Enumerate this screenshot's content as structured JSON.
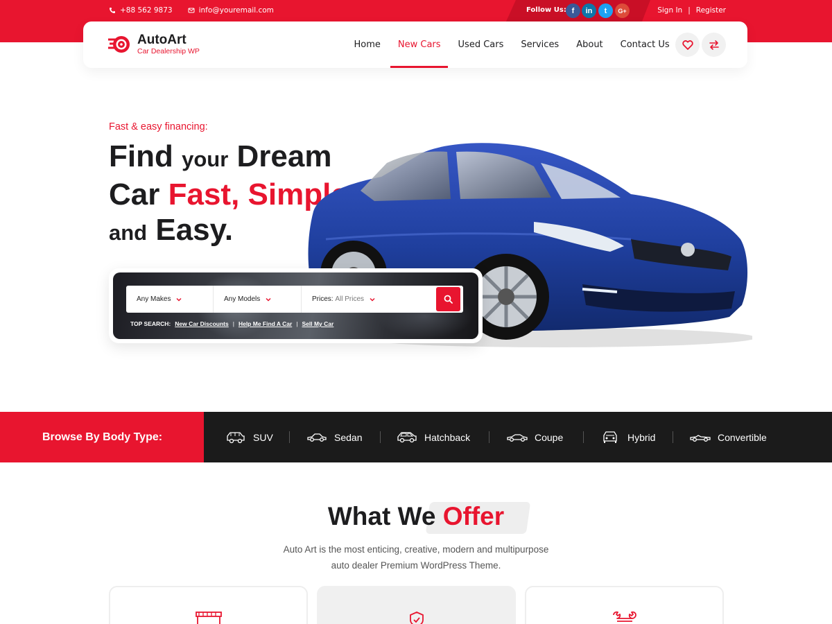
{
  "topbar": {
    "phone": "+88 562 9873",
    "email": "info@youremail.com",
    "follow_label": "Follow Us:",
    "social": [
      {
        "icon": "facebook-icon",
        "glyph": "f",
        "color": "#3b5998"
      },
      {
        "icon": "linkedin-icon",
        "glyph": "in",
        "color": "#0e76a8"
      },
      {
        "icon": "twitter-icon",
        "glyph": "t",
        "color": "#1da1f2"
      },
      {
        "icon": "google-plus-icon",
        "glyph": "G+",
        "color": "#dd4b39"
      }
    ],
    "sign_in": "Sign In",
    "divider": "|",
    "register": "Register"
  },
  "brand": {
    "name": "AutoArt",
    "tagline": "Car Dealership WP"
  },
  "nav": {
    "items": [
      "Home",
      "New Cars",
      "Used Cars",
      "Services",
      "About",
      "Contact Us"
    ],
    "active": "New Cars"
  },
  "header_actions": [
    "heart-icon",
    "compare-arrows-icon"
  ],
  "hero": {
    "kicker": "Fast & easy financing:",
    "line1_a": "Find",
    "line1_b": "your",
    "line1_c": "Dream",
    "line2_a": "Car",
    "line2_b": "Fast, Simple",
    "line3_a": "and",
    "line3_b": "Easy."
  },
  "search": {
    "makes": "Any Makes",
    "models": "Any Models",
    "prices_label": "Prices:",
    "prices_value": "All Prices",
    "top_search_label": "TOP SEARCH:",
    "links": [
      "New Car Discounts",
      "Help Me Find A Car",
      "Sell My Car"
    ],
    "separator": "|"
  },
  "body_types": {
    "title": "Browse By Body Type:",
    "items": [
      {
        "label": "SUV",
        "icon": "suv-icon"
      },
      {
        "label": "Sedan",
        "icon": "sedan-icon"
      },
      {
        "label": "Hatchback",
        "icon": "hatchback-icon"
      },
      {
        "label": "Coupe",
        "icon": "coupe-icon"
      },
      {
        "label": "Hybrid",
        "icon": "hybrid-icon"
      },
      {
        "label": "Convertible",
        "icon": "convertible-icon"
      }
    ]
  },
  "offer": {
    "title_a": "What We",
    "title_b": "Offer",
    "desc_line1": "Auto Art is the most enticing, creative, modern and multipurpose",
    "desc_line2": "auto dealer Premium WordPress Theme.",
    "cards": [
      "showroom-icon",
      "shield-check-icon",
      "wrench-icon"
    ]
  },
  "colors": {
    "accent": "#e8152f",
    "dark": "#1b1b1b",
    "car_blue": "#1f3f9e"
  }
}
